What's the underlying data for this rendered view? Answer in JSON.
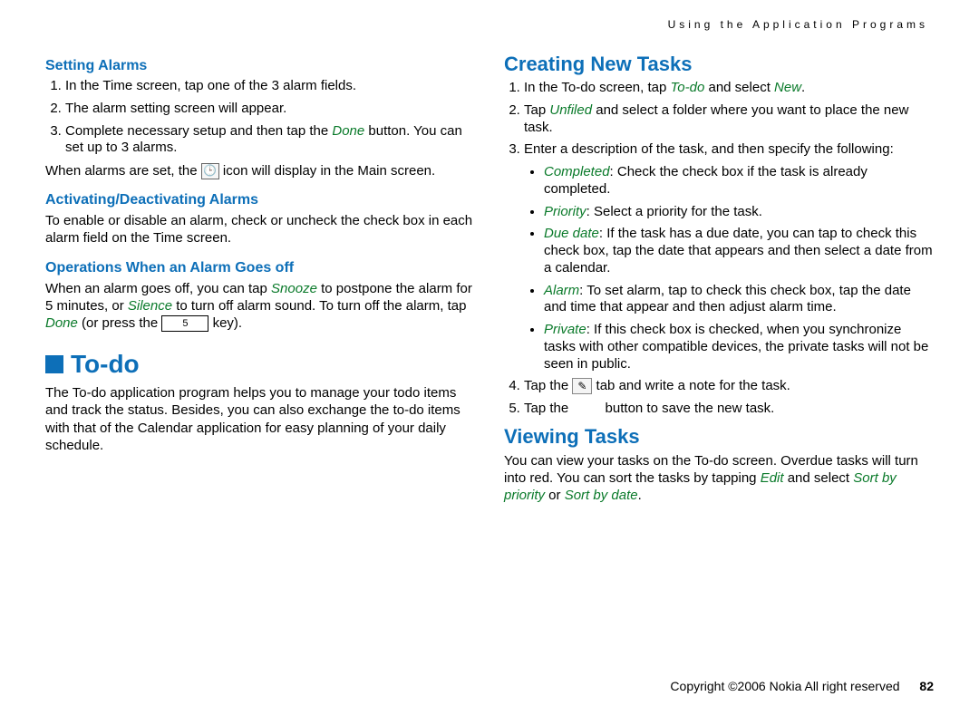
{
  "header": {
    "breadcrumb": "Using the Application Programs"
  },
  "left": {
    "setting_alarms": {
      "title": "Setting Alarms",
      "step1": "In the Time screen, tap one of the 3 alarm fields.",
      "step2": "The alarm setting screen will appear.",
      "step3_a": "Complete necessary setup and then tap the ",
      "step3_done": "Done",
      "step3_b": " button. You can set up to 3 alarms.",
      "note_a": "When alarms are set, the ",
      "note_b": " icon will display in the Main screen."
    },
    "activating": {
      "title": "Activating/Deactivating Alarms",
      "body": "To enable or disable an alarm, check or uncheck the check box in each alarm field on the Time screen."
    },
    "operations": {
      "title": "Operations When an Alarm Goes off",
      "body_a": "When an alarm goes off, you can tap ",
      "snooze": "Snooze",
      "body_b": " to postpone the alarm for 5 minutes, or ",
      "silence": "Silence",
      "body_c": " to turn off alarm sound. To turn off the alarm, tap ",
      "done": "Done",
      "body_d": " (or press the ",
      "key": "5",
      "body_e": " key)."
    },
    "todo": {
      "title": "To-do",
      "body": "The To-do application program helps you to manage your todo items and track the status. Besides, you can also exchange the to-do items with that of the Calendar application for easy planning of your daily schedule."
    }
  },
  "right": {
    "creating": {
      "title": "Creating New Tasks",
      "step1_a": "In the To-do screen, tap ",
      "step1_todo": "To-do",
      "step1_b": " and select ",
      "step1_new": "New",
      "step1_c": ".",
      "step2_a": "Tap ",
      "step2_unfiled": "Unfiled",
      "step2_b": " and select a folder where you want to place the new task.",
      "step3": "Enter a description of the task, and then specify the following:",
      "b_completed_label": "Completed",
      "b_completed_text": ": Check the check box if the task is already completed.",
      "b_priority_label": "Priority",
      "b_priority_text": ": Select a priority for the task.",
      "b_duedate_label": "Due date",
      "b_duedate_text": ": If the task has a due date, you can tap to check this check box, tap the date that appears and then select a date from a calendar.",
      "b_alarm_label": "Alarm",
      "b_alarm_text": ": To set alarm, tap to check this check box, tap the date and time that appear and then adjust alarm time.",
      "b_private_label": "Private",
      "b_private_text": ": If this check box is checked, when you synchronize tasks with other compatible devices, the private tasks will not be seen in public.",
      "step4_a": "Tap the ",
      "step4_b": " tab and write a note for the task.",
      "step5_a": "Tap the ",
      "step5_b": " button to save the new task."
    },
    "viewing": {
      "title": "Viewing Tasks",
      "body_a": "You can view your tasks on the To-do screen. Overdue tasks will turn into red. You can sort the tasks by tapping ",
      "edit": "Edit",
      "body_b": " and select ",
      "sort_priority": "Sort by priority",
      "or": " or ",
      "sort_date": "Sort by date",
      "body_c": "."
    }
  },
  "footer": {
    "copyright": "Copyright ©2006 Nokia All right reserved",
    "page": "82"
  }
}
